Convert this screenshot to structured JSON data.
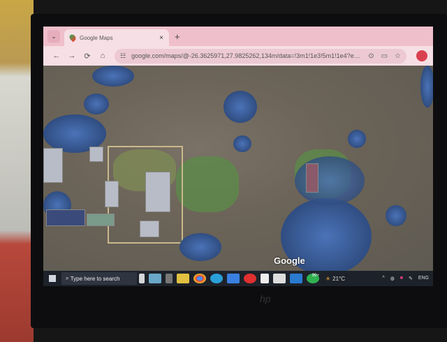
{
  "browser": {
    "tab": {
      "title": "Google Maps",
      "close": "×",
      "icon": "maps-pin-icon"
    },
    "new_tab": "+",
    "tab_search": "⌄",
    "nav": {
      "back": "←",
      "forward": "→",
      "reload": "⟳",
      "home": "⌂"
    },
    "url": "google.com/maps/@-26.3625971,27.9825262,134m/data=!3m1!1e3!5m1!1e4?entry...",
    "address_icons": [
      "location-icon",
      "cast-icon",
      "star-icon"
    ]
  },
  "map": {
    "view": "satellite",
    "watermark": "Google"
  },
  "taskbar": {
    "search_placeholder": "Type here to search",
    "apps": [
      "task-view",
      "file-explorer",
      "chrome",
      "edge",
      "dropbox",
      "opera",
      "notepad",
      "capcut",
      "outlook",
      "whatsapp"
    ],
    "whatsapp_badge": "99+",
    "weather": "21°C",
    "language": "ENG"
  },
  "monitor": {
    "brand": "hp"
  }
}
